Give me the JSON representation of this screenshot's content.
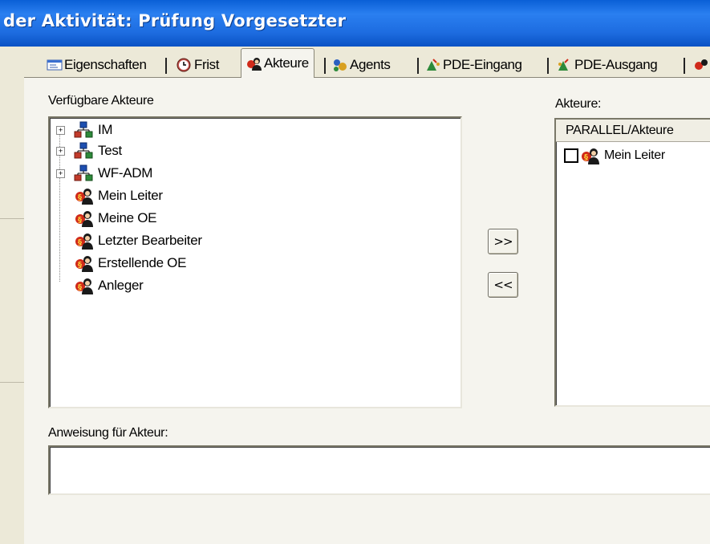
{
  "window": {
    "title": "der Aktivität: Prüfung Vorgesetzter"
  },
  "tabs": [
    {
      "label": "Eigenschaften",
      "icon": "properties-icon",
      "active": false
    },
    {
      "label": "Frist",
      "icon": "clock-icon",
      "active": false
    },
    {
      "label": "Akteure",
      "icon": "actors-icon",
      "active": true
    },
    {
      "label": "Agents",
      "icon": "agents-icon",
      "active": false
    },
    {
      "label": "PDE-Eingang",
      "icon": "pde-in-icon",
      "active": false
    },
    {
      "label": "PDE-Ausgang",
      "icon": "pde-out-icon",
      "active": false
    }
  ],
  "available": {
    "label": "Verfügbare Akteure",
    "groups": [
      {
        "label": "IM",
        "icon": "org-group-icon"
      },
      {
        "label": "Test",
        "icon": "org-group-icon"
      },
      {
        "label": "WF-ADM",
        "icon": "org-group-icon"
      }
    ],
    "persons": [
      {
        "label": "Mein Leiter",
        "icon": "person-icon"
      },
      {
        "label": "Meine OE",
        "icon": "person-icon"
      },
      {
        "label": "Letzter Bearbeiter",
        "icon": "person-icon"
      },
      {
        "label": "Erstellende OE",
        "icon": "person-icon"
      },
      {
        "label": "Anleger",
        "icon": "person-icon"
      }
    ]
  },
  "buttons": {
    "add": ">>",
    "remove": "<<"
  },
  "assigned": {
    "label": "Akteure:",
    "column_header": "PARALLEL/Akteure",
    "items": [
      {
        "label": "Mein Leiter",
        "checked": false
      }
    ]
  },
  "instruction": {
    "label": "Anweisung für Akteur:",
    "value": ""
  }
}
